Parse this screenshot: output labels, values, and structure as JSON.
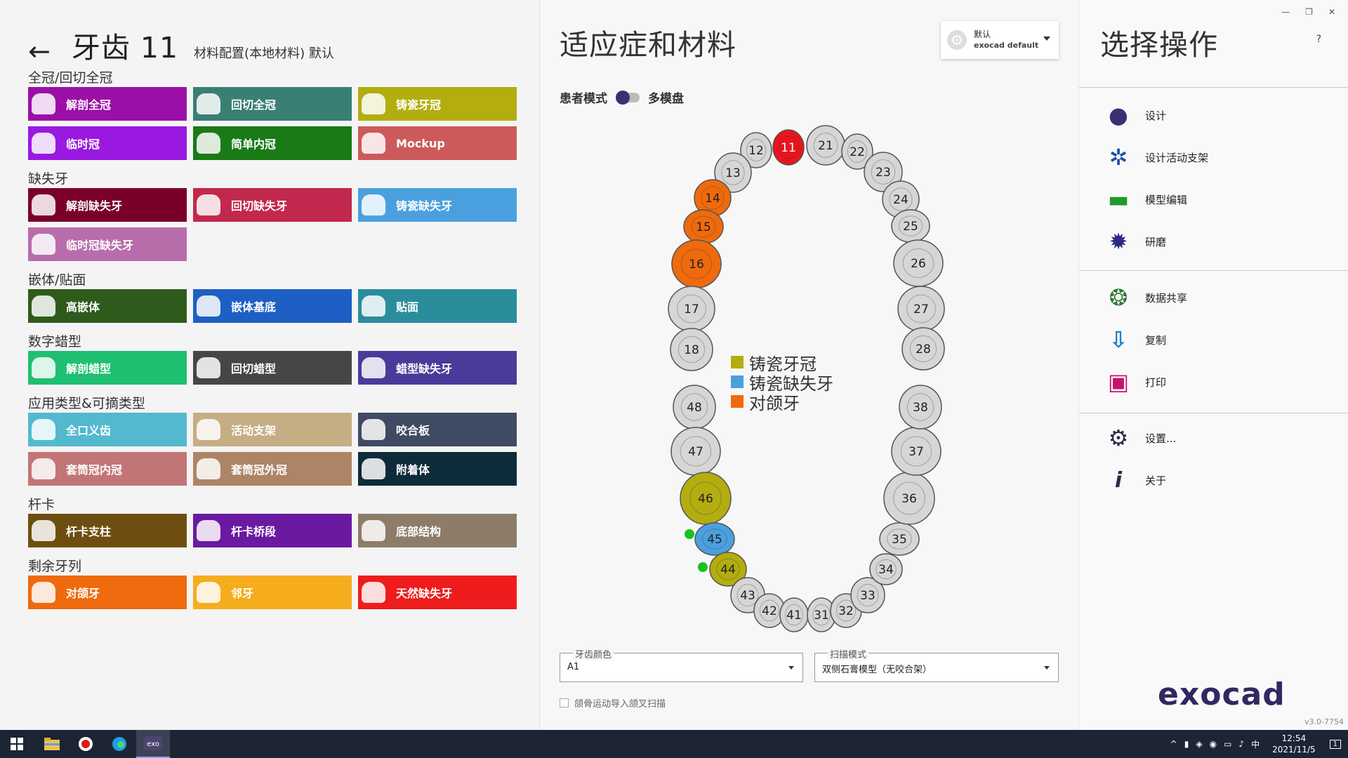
{
  "left": {
    "title": "牙齿 11",
    "subtitle": "材料配置(本地材料) 默认",
    "sections": [
      {
        "label": "全冠/回切全冠",
        "buttons": [
          {
            "label": "解剖全冠",
            "color": "#9b0fa8"
          },
          {
            "label": "回切全冠",
            "color": "#3a7f74"
          },
          {
            "label": "铸瓷牙冠",
            "color": "#b3ad10"
          },
          {
            "label": "临时冠",
            "color": "#9a19e0"
          },
          {
            "label": "简单内冠",
            "color": "#1a7a16"
          },
          {
            "label": "Mockup",
            "color": "#cd5a5a"
          }
        ]
      },
      {
        "label": "缺失牙",
        "buttons": [
          {
            "label": "解剖缺失牙",
            "color": "#7a0029"
          },
          {
            "label": "回切缺失牙",
            "color": "#c2284d"
          },
          {
            "label": "铸瓷缺失牙",
            "color": "#4aa0de"
          },
          {
            "label": "临时冠缺失牙",
            "color": "#b86dab"
          }
        ]
      },
      {
        "label": "嵌体/贴面",
        "buttons": [
          {
            "label": "高嵌体",
            "color": "#2e5b1c"
          },
          {
            "label": "嵌体基底",
            "color": "#1d5fc4"
          },
          {
            "label": "贴面",
            "color": "#2a8d9b"
          }
        ]
      },
      {
        "label": "数字蜡型",
        "buttons": [
          {
            "label": "解剖蜡型",
            "color": "#1fbf72"
          },
          {
            "label": "回切蜡型",
            "color": "#464646"
          },
          {
            "label": "蜡型缺失牙",
            "color": "#483b9a"
          }
        ]
      },
      {
        "label": "应用类型&可摘类型",
        "buttons": [
          {
            "label": "全口义齿",
            "color": "#52b9cf"
          },
          {
            "label": "活动支架",
            "color": "#c5ad84"
          },
          {
            "label": "咬合板",
            "color": "#3f4a63"
          },
          {
            "label": "套筒冠内冠",
            "color": "#c27576"
          },
          {
            "label": "套筒冠外冠",
            "color": "#ad8466"
          },
          {
            "label": "附着体",
            "color": "#0e2b3a"
          }
        ]
      },
      {
        "label": "杆卡",
        "buttons": [
          {
            "label": "杆卡支柱",
            "color": "#6e4e10"
          },
          {
            "label": "杆卡桥段",
            "color": "#6a1aa0"
          },
          {
            "label": "底部结构",
            "color": "#8c7c68"
          }
        ]
      },
      {
        "label": "剩余牙列",
        "buttons": [
          {
            "label": "对颌牙",
            "color": "#ef6a0d"
          },
          {
            "label": "邻牙",
            "color": "#f5ad1d"
          },
          {
            "label": "天然缺失牙",
            "color": "#ee1c1c"
          }
        ]
      }
    ]
  },
  "middle": {
    "title": "适应症和材料",
    "preset": {
      "line1": "默认",
      "line2": "exocad default"
    },
    "patient_mode_label": "患者模式",
    "multi_die_label": "多模盘",
    "legend": [
      {
        "label": "铸瓷牙冠",
        "color": "#b3ad10"
      },
      {
        "label": "铸瓷缺失牙",
        "color": "#4aa0de"
      },
      {
        "label": "对颌牙",
        "color": "#ef6a0d"
      }
    ],
    "teeth": [
      {
        "n": "11",
        "state": "selected"
      },
      {
        "n": "12",
        "state": "none"
      },
      {
        "n": "13",
        "state": "none"
      },
      {
        "n": "14",
        "state": "antagonist"
      },
      {
        "n": "15",
        "state": "antagonist"
      },
      {
        "n": "16",
        "state": "antagonist"
      },
      {
        "n": "17",
        "state": "none"
      },
      {
        "n": "18",
        "state": "none"
      },
      {
        "n": "21",
        "state": "none"
      },
      {
        "n": "22",
        "state": "none"
      },
      {
        "n": "23",
        "state": "none"
      },
      {
        "n": "24",
        "state": "none"
      },
      {
        "n": "25",
        "state": "none"
      },
      {
        "n": "26",
        "state": "none"
      },
      {
        "n": "27",
        "state": "none"
      },
      {
        "n": "28",
        "state": "none"
      },
      {
        "n": "48",
        "state": "none"
      },
      {
        "n": "47",
        "state": "none"
      },
      {
        "n": "46",
        "state": "crown"
      },
      {
        "n": "45",
        "state": "pontic"
      },
      {
        "n": "44",
        "state": "crown"
      },
      {
        "n": "43",
        "state": "none"
      },
      {
        "n": "42",
        "state": "none"
      },
      {
        "n": "41",
        "state": "none"
      },
      {
        "n": "31",
        "state": "none"
      },
      {
        "n": "32",
        "state": "none"
      },
      {
        "n": "33",
        "state": "none"
      },
      {
        "n": "34",
        "state": "none"
      },
      {
        "n": "35",
        "state": "none"
      },
      {
        "n": "36",
        "state": "none"
      },
      {
        "n": "37",
        "state": "none"
      },
      {
        "n": "38",
        "state": "none"
      }
    ],
    "state_colors": {
      "none": "#d6d6d6",
      "selected": "#e8141e",
      "antagonist": "#ef6a0d",
      "crown": "#b3ad10",
      "pontic": "#4aa0de"
    },
    "connector_color": "#19c21f",
    "tooth_color_field": {
      "label": "牙齿颜色",
      "value": "A1"
    },
    "scan_mode_field": {
      "label": "扫描模式",
      "value": "双侧石膏模型（无咬合架）"
    },
    "jaw_checkbox_label": "颌骨运动导入颌叉扫描"
  },
  "right": {
    "title": "选择操作",
    "help": "?",
    "actions_group1": [
      {
        "label": "设计",
        "icon": "design-icon"
      },
      {
        "label": "设计活动支架",
        "icon": "partial-framework-icon"
      },
      {
        "label": "模型编辑",
        "icon": "model-edit-icon"
      },
      {
        "label": "研磨",
        "icon": "milling-icon"
      }
    ],
    "actions_group2": [
      {
        "label": "数据共享",
        "icon": "data-share-icon"
      },
      {
        "label": "复制",
        "icon": "copy-icon"
      },
      {
        "label": "打印",
        "icon": "print-icon"
      }
    ],
    "actions_group3": [
      {
        "label": "设置...",
        "icon": "settings-icon"
      },
      {
        "label": "关于",
        "icon": "about-icon"
      }
    ],
    "logo": "exocad",
    "version": "v3.0-7754"
  },
  "taskbar": {
    "time": "12:54",
    "date": "2021/11/5",
    "ime": "中",
    "notification_count": "1"
  }
}
